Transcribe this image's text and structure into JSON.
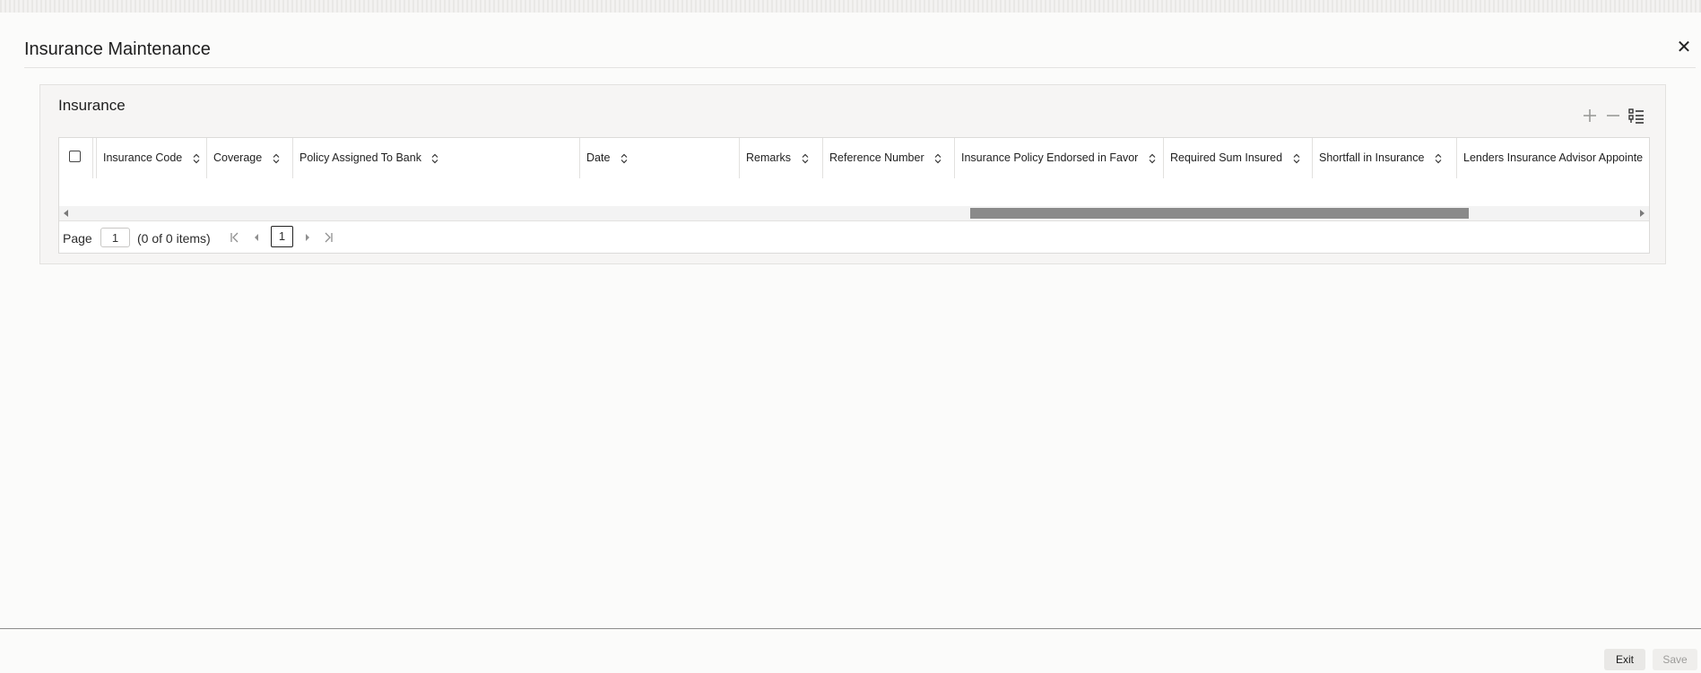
{
  "dialog": {
    "title": "Insurance Maintenance",
    "close_icon": "close-icon"
  },
  "section": {
    "title": "Insurance",
    "toolbar": {
      "add_icon": "plus-icon",
      "remove_icon": "minus-icon",
      "columns_icon": "list-columns-icon"
    }
  },
  "grid": {
    "columns": [
      "Insurance Code",
      "Coverage",
      "Policy Assigned To Bank",
      "Date",
      "Remarks",
      "Reference Number",
      "Insurance Policy Endorsed in Favor",
      "Required Sum Insured",
      "Shortfall in Insurance",
      "Lenders Insurance Advisor Appointe"
    ],
    "rows": []
  },
  "pager": {
    "page_label": "Page",
    "page_value": "1",
    "items_text": "(0 of 0 items)",
    "current_page": "1"
  },
  "footer": {
    "exit_label": "Exit",
    "save_label": "Save"
  }
}
